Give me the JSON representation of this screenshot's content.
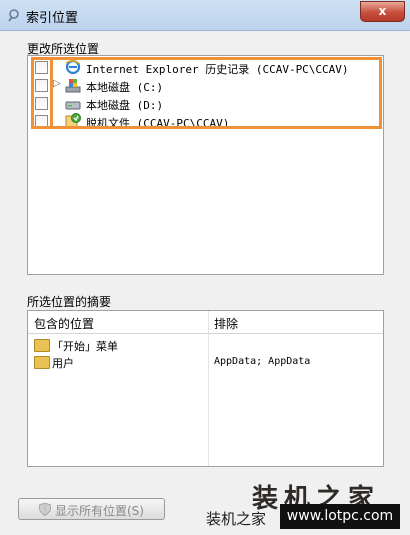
{
  "window": {
    "title": "索引位置",
    "close_glyph": "x"
  },
  "change_section": {
    "label": "更改所选位置",
    "items": [
      {
        "label": "Internet Explorer 历史记录 (CCAV-PC\\CCAV)",
        "icon": "ie-icon",
        "has_expander": false
      },
      {
        "label": "本地磁盘 (C:)",
        "icon": "system-drive-icon",
        "has_expander": true
      },
      {
        "label": "本地磁盘 (D:)",
        "icon": "drive-icon",
        "has_expander": false
      },
      {
        "label": "脱机文件 (CCAV-PC\\CCAV)",
        "icon": "offline-files-icon",
        "has_expander": false
      }
    ],
    "expander_glyph": "▷"
  },
  "summary_section": {
    "label": "所选位置的摘要",
    "columns": [
      "包含的位置",
      "排除"
    ],
    "rows": [
      {
        "name": "「开始」菜单",
        "exclude": ""
      },
      {
        "name": "用户",
        "exclude": "AppData; AppData"
      }
    ]
  },
  "buttons": {
    "show_all": "显示所有位置(S)"
  },
  "watermark": {
    "title": "装机之家",
    "subtitle": "装机之家",
    "url": "www.lotpc.com"
  },
  "colors": {
    "highlight": "#f0913a"
  }
}
